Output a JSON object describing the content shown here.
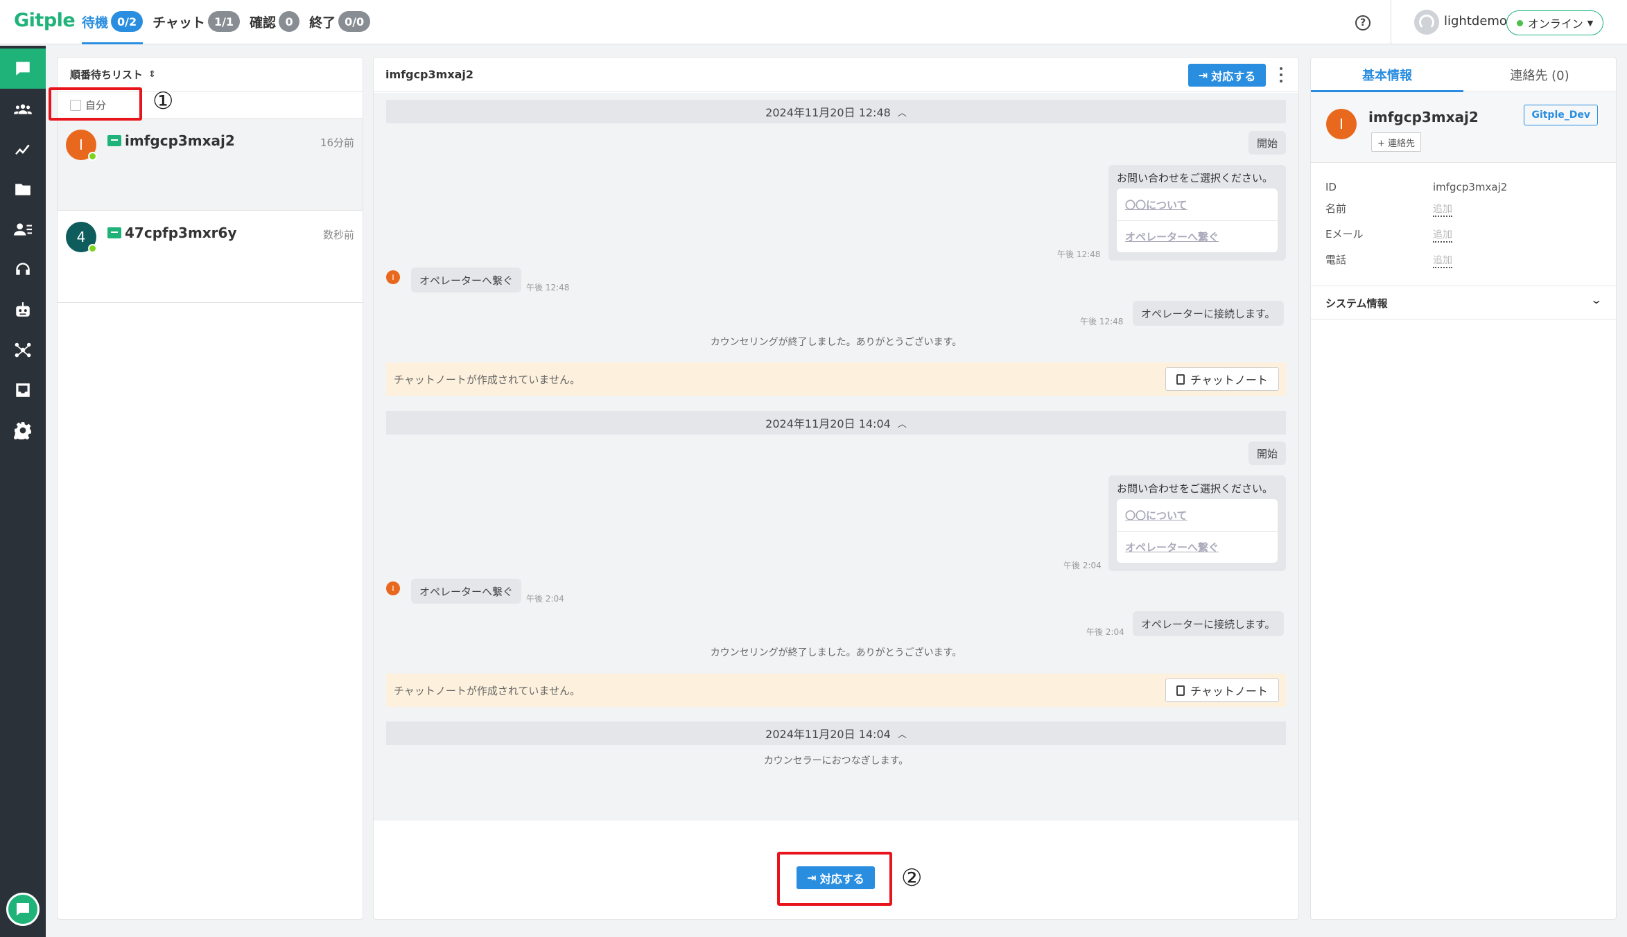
{
  "topbar": {
    "logo": "Gitple",
    "tabs": [
      {
        "label": "待機",
        "count": "0/2",
        "active": true
      },
      {
        "label": "チャット",
        "count": "1/1",
        "active": false
      },
      {
        "label": "確認",
        "count": "0",
        "active": false
      },
      {
        "label": "終了",
        "count": "0/0",
        "active": false
      }
    ],
    "help_icon": "question-icon",
    "user_name": "lightdemo",
    "status": "オンライン",
    "status_color": "#4cc04c"
  },
  "nav": {
    "items": [
      "chat-icon",
      "team-icon",
      "stats-icon",
      "folder-icon",
      "contacts-icon",
      "headset-icon",
      "bot-icon",
      "integration-icon",
      "inbox-icon",
      "settings-icon"
    ],
    "active": "chat-icon",
    "bottom": "chat-widget-icon"
  },
  "queue": {
    "title": "順番待ちリスト",
    "filter_label": "自分",
    "items": [
      {
        "initial": "I",
        "name": "imfgcp3mxaj2",
        "time": "16分前",
        "avatar_color": "#e8681e"
      },
      {
        "initial": "4",
        "name": "47cpfp3mxr6y",
        "time": "数秒前",
        "avatar_color": "#0e5c5c"
      }
    ]
  },
  "chat": {
    "title": "imfgcp3mxaj2",
    "respond_label": "対応する",
    "sessions": [
      {
        "date": "2024年11月20日 12:48",
        "start": "開始",
        "question": "お問い合わせをご選択ください。",
        "options": [
          "〇〇について",
          "オペレーターへ繋ぐ"
        ],
        "question_time": "午後 12:48",
        "user_msg": "オペレーターへ繋ぐ",
        "user_time": "午後 12:48",
        "reply": "オペレーターに接続します。",
        "reply_time": "午後 12:48",
        "end_msg": "カウンセリングが終了しました。ありがとうございます。",
        "note_text": "チャットノートが作成されていません。",
        "note_button": "チャットノート"
      },
      {
        "date": "2024年11月20日 14:04",
        "start": "開始",
        "question": "お問い合わせをご選択ください。",
        "options": [
          "〇〇について",
          "オペレーターへ繋ぐ"
        ],
        "question_time": "午後 2:04",
        "user_msg": "オペレーターへ繋ぐ",
        "user_time": "午後 2:04",
        "reply": "オペレーターに接続します。",
        "reply_time": "午後 2:04",
        "end_msg": "カウンセリングが終了しました。ありがとうございます。",
        "note_text": "チャットノートが作成されていません。",
        "note_button": "チャットノート"
      }
    ],
    "last_date": "2024年11月20日 14:04",
    "last_msg": "カウンセラーにおつなぎします。",
    "user_initial": "I"
  },
  "annotations": [
    "①",
    "②"
  ],
  "info": {
    "tabs": [
      "基本情報",
      "連絡先 (0)"
    ],
    "initial": "I",
    "name": "imfgcp3mxaj2",
    "contact_button": "+ 連絡先",
    "tag": "Gitple_Dev",
    "fields": [
      {
        "label": "ID",
        "value": "imfgcp3mxaj2"
      },
      {
        "label": "名前",
        "value": "追加"
      },
      {
        "label": "Eメール",
        "value": "追加"
      },
      {
        "label": "電話",
        "value": "追加"
      }
    ],
    "system_info": "システム情報"
  }
}
